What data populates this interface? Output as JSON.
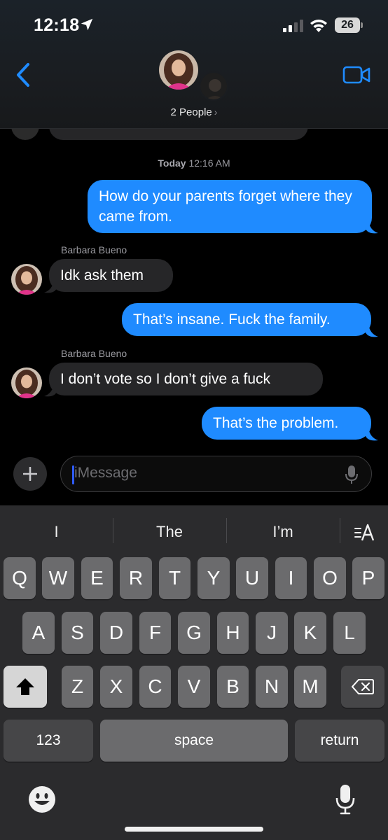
{
  "status_bar": {
    "time": "12:18",
    "battery": "26"
  },
  "header": {
    "participants": "2 People",
    "chevron": "›"
  },
  "conversation": {
    "timestamp_day": "Today",
    "timestamp_time": "12:16 AM",
    "messages": [
      {
        "direction": "outgoing",
        "text": "How do your parents forget where they came from."
      },
      {
        "direction": "incoming",
        "sender": "Barbara Bueno",
        "text": "Idk ask them"
      },
      {
        "direction": "outgoing",
        "text": "That’s insane. Fuck the family."
      },
      {
        "direction": "incoming",
        "sender": "Barbara Bueno",
        "text": "I don’t vote so I don’t give a fuck"
      },
      {
        "direction": "outgoing",
        "text": "That’s the problem."
      }
    ]
  },
  "input": {
    "placeholder": "iMessage"
  },
  "keyboard": {
    "suggestions": [
      "I",
      "The",
      "I’m"
    ],
    "row1": [
      "Q",
      "W",
      "E",
      "R",
      "T",
      "Y",
      "U",
      "I",
      "O",
      "P"
    ],
    "row2": [
      "A",
      "S",
      "D",
      "F",
      "G",
      "H",
      "J",
      "K",
      "L"
    ],
    "row3": [
      "Z",
      "X",
      "C",
      "V",
      "B",
      "N",
      "M"
    ],
    "numbers_key": "123",
    "space_key": "space",
    "return_key": "return"
  },
  "colors": {
    "outgoing_bubble": "#1f8bff",
    "incoming_bubble": "#262628",
    "accent": "#1f8bff"
  },
  "icons": [
    "location-arrow-icon",
    "cellular-signal-icon",
    "wifi-icon",
    "battery-icon",
    "chevron-left-icon",
    "video-camera-icon",
    "plus-icon",
    "microphone-icon",
    "text-format-icon",
    "shift-icon",
    "delete-icon",
    "emoji-icon",
    "dictation-icon"
  ]
}
